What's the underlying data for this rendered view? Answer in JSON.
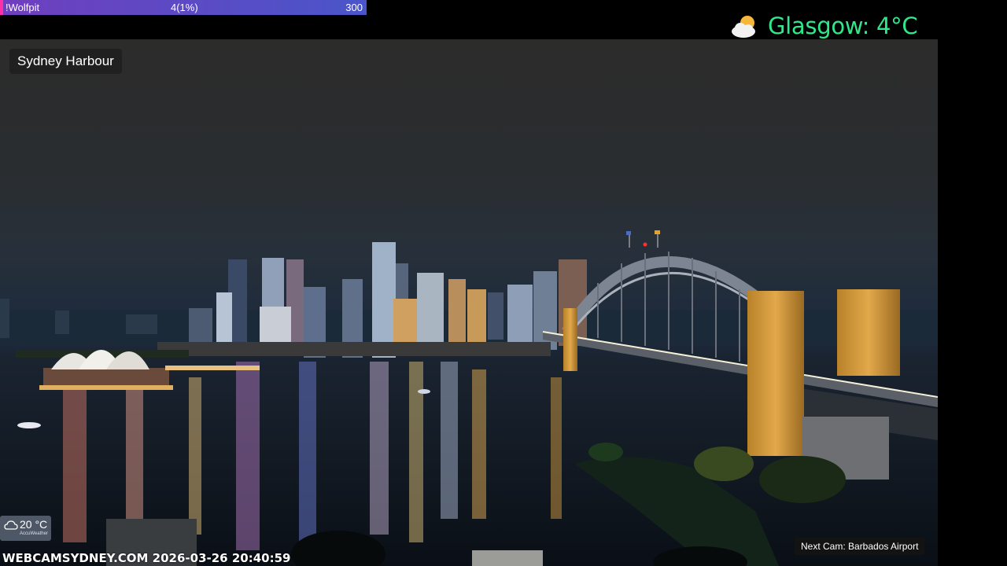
{
  "overlay": {
    "name": "!Wolfpit",
    "progress_text": "4(1%)",
    "goal": "300",
    "progress_fraction": 0.01
  },
  "weather": {
    "icon": "partly-cloudy-icon",
    "text": "Glasgow: 4°C",
    "color": "#2ee88a"
  },
  "camera": {
    "title": "Sydney Harbour",
    "timestamp": "WEBCAMSYDNEY.COM 2026-03-26 20:40:59",
    "next_cam": "Next Cam: Barbados Airport"
  },
  "accuweather": {
    "temp": "20 °C",
    "brand": "AccuWeather",
    "icon": "cloud-icon"
  }
}
